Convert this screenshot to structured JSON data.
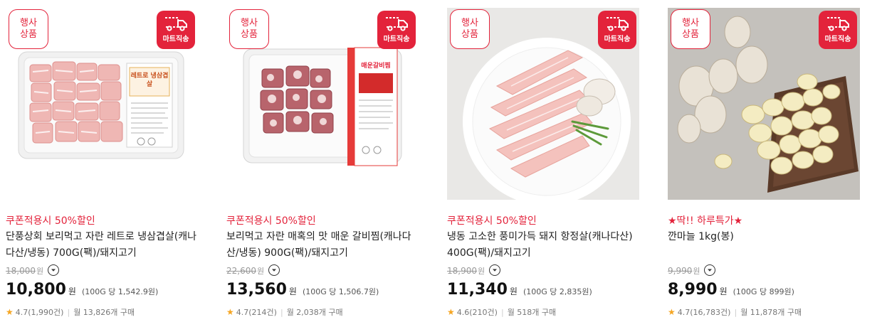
{
  "badges": {
    "event": "행사상품",
    "delivery": "마트직송"
  },
  "products": [
    {
      "tag": "쿠폰적용시 50%할인",
      "name": "단풍상회 보리먹고 자란 레트로 냉삼겹살(캐나다산/냉동) 700G(팩)/돼지고기",
      "original_price": "18,000",
      "original_unit": "원",
      "price": "10,800",
      "price_unit": "원",
      "unit_price": "(100G 당 1,542.9원)",
      "rating": "4.7",
      "reviews": "(1,990건)",
      "sales": "월 13,826개 구매",
      "package_label": "레트로 냉삼겹살"
    },
    {
      "tag": "쿠폰적용시 50%할인",
      "name": "보리먹고 자란 매혹의 맛 매운 갈비찜(캐나다산/냉동) 900G(팩)/돼지고기",
      "original_price": "22,600",
      "original_unit": "원",
      "price": "13,560",
      "price_unit": "원",
      "unit_price": "(100G 당 1,506.7원)",
      "rating": "4.7",
      "reviews": "(214건)",
      "sales": "월 2,038개 구매",
      "package_label": "매운갈비찜"
    },
    {
      "tag": "쿠폰적용시 50%할인",
      "name": "냉동 고소한 풍미가득 돼지 항정살(캐나다산) 400G(팩)/돼지고기",
      "original_price": "18,900",
      "original_unit": "원",
      "price": "11,340",
      "price_unit": "원",
      "unit_price": "(100G 당 2,835원)",
      "rating": "4.6",
      "reviews": "(210건)",
      "sales": "월 518개 구매"
    },
    {
      "tag": "★딱!! 하루특가★",
      "name": "깐마늘 1kg(봉)",
      "original_price": "9,990",
      "original_unit": "원",
      "price": "8,990",
      "price_unit": "원",
      "unit_price": "(100G 당 899원)",
      "rating": "4.7",
      "reviews": "(16,783건)",
      "sales": "월 11,878개 구매"
    }
  ],
  "colors": {
    "accent": "#e3233b",
    "star": "#f5a623"
  }
}
